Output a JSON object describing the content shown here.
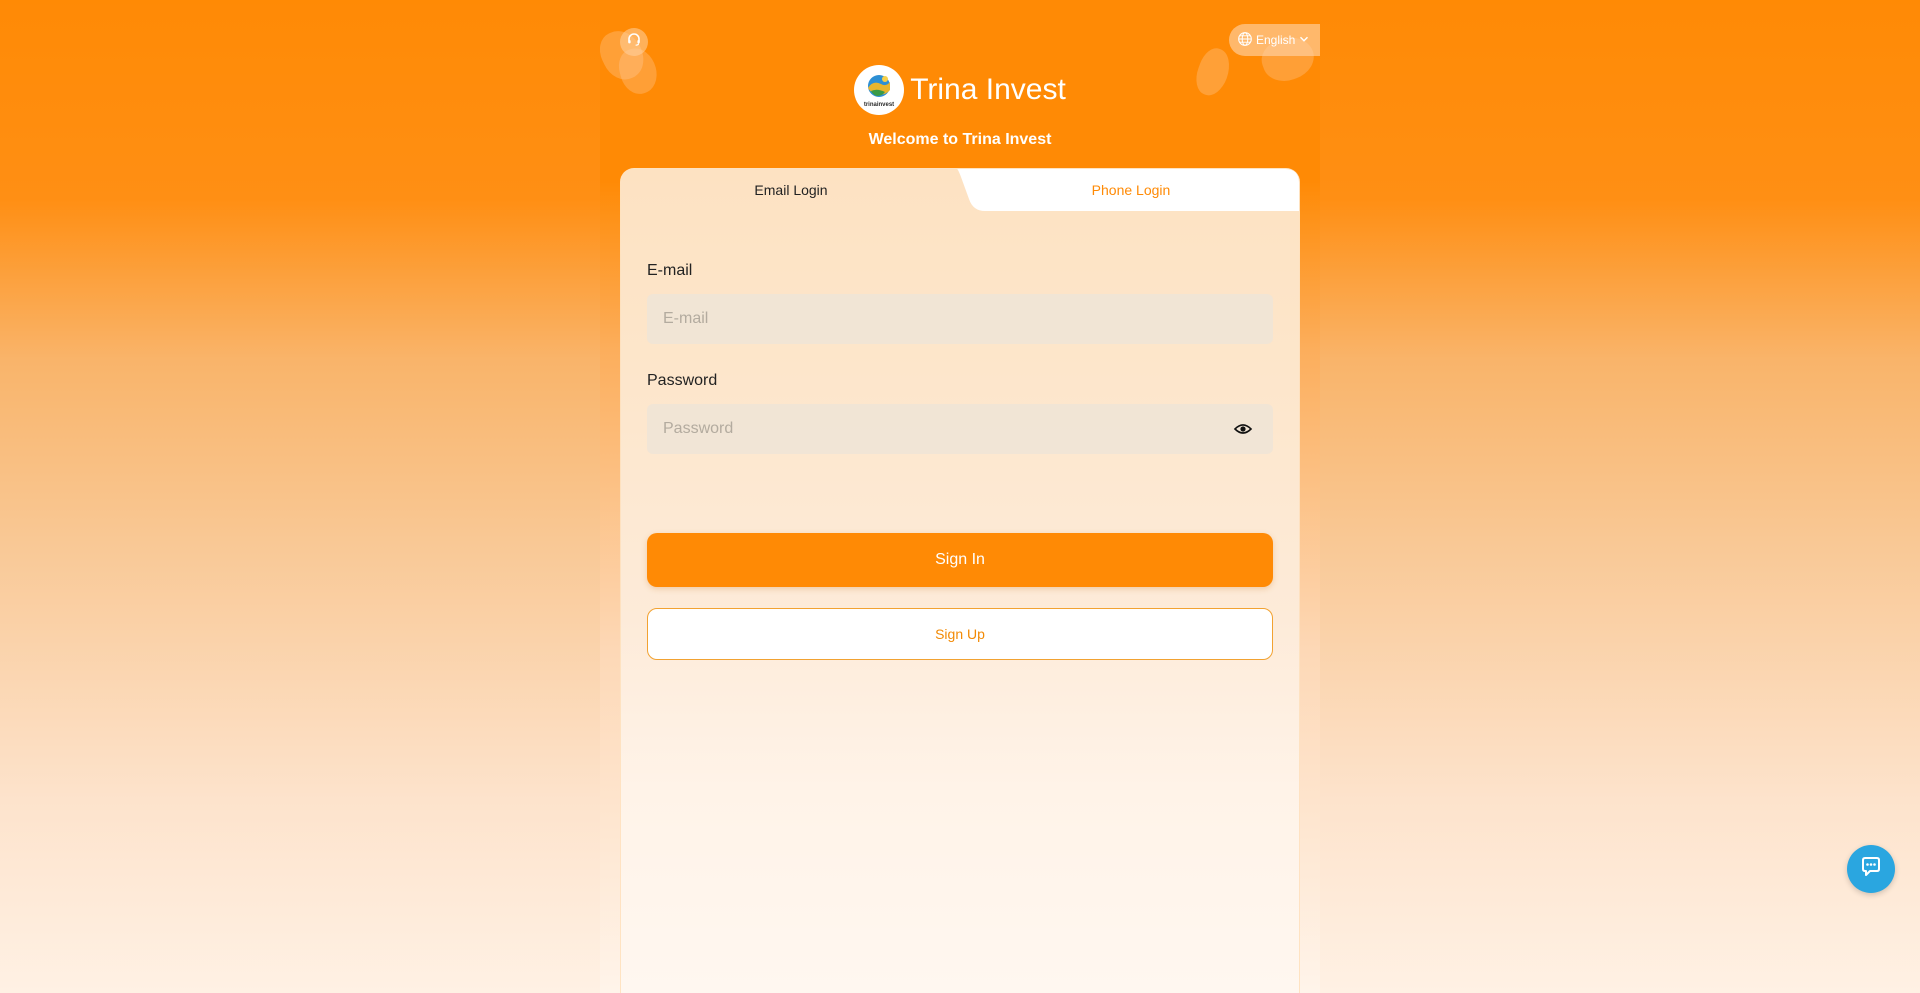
{
  "header": {
    "language_label": "English",
    "brand_name": "Trina Invest",
    "logo_text": "trinainvest",
    "welcome": "Welcome to Trina Invest"
  },
  "tabs": [
    {
      "label": "Email Login",
      "active": true
    },
    {
      "label": "Phone Login",
      "active": false
    }
  ],
  "form": {
    "email_label": "E-mail",
    "email_placeholder": "E-mail",
    "email_value": "",
    "password_label": "Password",
    "password_placeholder": "Password",
    "password_value": ""
  },
  "actions": {
    "sign_in": "Sign In",
    "sign_up": "Sign Up"
  },
  "icons": {
    "support": "headset-icon",
    "language": "globe-icon",
    "language_caret": "chevron-down-icon",
    "password_toggle": "eye-icon",
    "chat": "chat-bubble-icon"
  },
  "colors": {
    "accent": "#ff8a05",
    "chat": "#2aa6e0",
    "tab_inactive_text": "#ff8a05"
  }
}
